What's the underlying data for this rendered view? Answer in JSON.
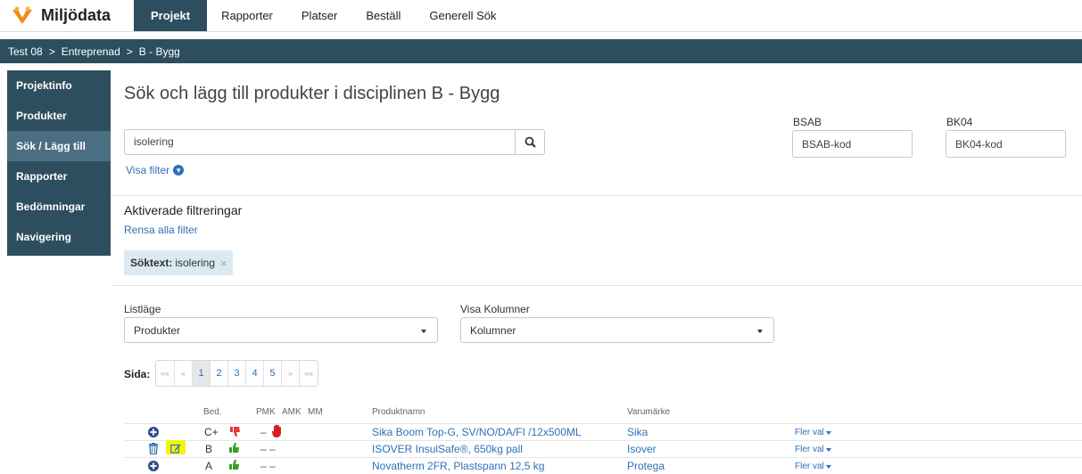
{
  "brand": {
    "name": "Miljödata",
    "icon": "miljodata-logo"
  },
  "topnav": [
    "Projekt",
    "Rapporter",
    "Platser",
    "Beställ",
    "Generell Sök"
  ],
  "breadcrumb": {
    "items": [
      "Test 08",
      "Entreprenad",
      "B - Bygg"
    ],
    "separator": ">"
  },
  "sidebar": [
    "Projektinfo",
    "Produkter",
    "Sök / Lägg till",
    "Rapporter",
    "Bedömningar",
    "Navigering"
  ],
  "main": {
    "title": "Sök och lägg till produkter i disciplinen B - Bygg",
    "search": {
      "value": "isolering",
      "icon": "search-icon"
    },
    "visa_filter": "Visa filter",
    "bsab": {
      "label": "BSAB",
      "placeholder": "BSAB-kod"
    },
    "bk04": {
      "label": "BK04",
      "placeholder": "BK04-kod"
    },
    "active_filters_title": "Aktiverade filtreringar",
    "clear_filters": "Rensa alla filter",
    "chip": {
      "key": "Söktext:",
      "value": "isolering",
      "close": "×"
    },
    "listlage": {
      "label": "Listläge",
      "value": "Produkter"
    },
    "visa_kolumner": {
      "label": "Visa Kolumner",
      "value": "Kolumner"
    },
    "pager": {
      "label": "Sida:",
      "first": "««",
      "prev": "«",
      "pages": [
        "1",
        "2",
        "3",
        "4",
        "5"
      ],
      "next": "»",
      "last": "»»",
      "current": "1"
    }
  },
  "table": {
    "headers": {
      "bed": "Bed.",
      "pmk": "PMK",
      "amk": "AMK",
      "mm": "MM",
      "name": "Produktnamn",
      "brand": "Varumärke"
    },
    "rows": [
      {
        "bed": "C+",
        "pmk": "–",
        "name": "Sika Boom Top-G, SV/NO/DA/FI /12x500ML",
        "brand": "Sika",
        "more": "Fler val",
        "icons": [
          "add-icon",
          "thumbs-down-icon",
          "stop-hand-icon"
        ]
      },
      {
        "bed": "B",
        "pmk": "– –",
        "name": "ISOVER InsulSafe®, 650kg pall",
        "brand": "Isover",
        "more": "Fler val",
        "icons": [
          "trash-icon",
          "edit-icon",
          "thumbs-up-icon"
        ]
      },
      {
        "bed": "A",
        "pmk": "– –",
        "name": "Novatherm 2FR, Plastspann 12,5 kg",
        "brand": "Protega",
        "more": "Fler val",
        "icons": [
          "add-icon",
          "thumbs-up-icon"
        ]
      }
    ]
  },
  "colors": {
    "nav_dark": "#2d4e5f",
    "sidebar_active": "#4b6e82",
    "link": "#2d72b6",
    "chip_bg": "#dbe9f2",
    "thumb_down": "#e53935",
    "thumb_up": "#3a9d23",
    "highlight": "#f4f40a"
  }
}
